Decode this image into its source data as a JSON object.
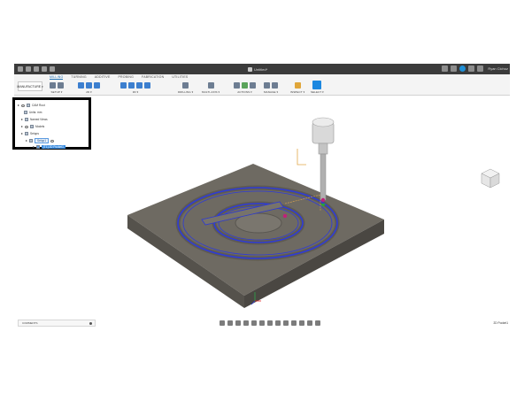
{
  "window": {
    "document_title": "Untitled*",
    "user_name": "Ryan Cichoz"
  },
  "ribbon": {
    "tabs": [
      {
        "label": "MILLING",
        "active": true
      },
      {
        "label": "TURNING",
        "active": false
      },
      {
        "label": "ADDITIVE",
        "active": false
      },
      {
        "label": "PROBING",
        "active": false
      },
      {
        "label": "FABRICATION",
        "active": false
      },
      {
        "label": "UTILITIES",
        "active": false
      }
    ],
    "workspace": "MANUFACTURE",
    "groups": [
      {
        "label": "SETUP ▾",
        "icons": [
          "setup-icon",
          "new-folder-icon"
        ]
      },
      {
        "label": "2D ▾",
        "icons": [
          "2d-adaptive-icon",
          "2d-pocket-icon",
          "2d-contour-icon"
        ]
      },
      {
        "label": "3D ▾",
        "icons": [
          "3d-adaptive-icon",
          "3d-pocket-icon",
          "3d-parallel-icon",
          "3d-scallop-icon"
        ]
      },
      {
        "label": "DRILLING ▾",
        "icons": [
          "drill-icon"
        ]
      },
      {
        "label": "MULTI-AXIS ▾",
        "icons": [
          "multi-axis-icon"
        ]
      },
      {
        "label": "ACTIONS ▾",
        "icons": [
          "generate-icon",
          "simulate-icon",
          "post-process-icon"
        ]
      },
      {
        "label": "MANAGE ▾",
        "icons": [
          "tool-library-icon",
          "templates-icon"
        ]
      },
      {
        "label": "INSPECT ▾",
        "icons": [
          "measure-icon"
        ]
      },
      {
        "label": "SELECT ▾",
        "icons": [
          "select-icon"
        ]
      }
    ]
  },
  "browser": {
    "rows": [
      {
        "label": "CAM Root",
        "level": 0,
        "style": "plain"
      },
      {
        "label": "Units: mm",
        "level": 1,
        "style": "plain"
      },
      {
        "label": "Named Views",
        "level": 1,
        "style": "plain"
      },
      {
        "label": "Models",
        "level": 1,
        "style": "plain"
      },
      {
        "label": "Setups",
        "level": 1,
        "style": "plain"
      },
      {
        "label": "Setup1",
        "level": 2,
        "style": "outline"
      },
      {
        "label": "[T1] 2D Pocket1",
        "level": 3,
        "style": "selected"
      }
    ]
  },
  "bottom": {
    "comments_label": "COMMENTS",
    "status_right": "2D Pocket1"
  },
  "colors": {
    "toolpath": "#2e3bd6",
    "stock_top": "#6e6a62",
    "stock_side": "#4f4c46",
    "accent": "#1f8fd6"
  }
}
